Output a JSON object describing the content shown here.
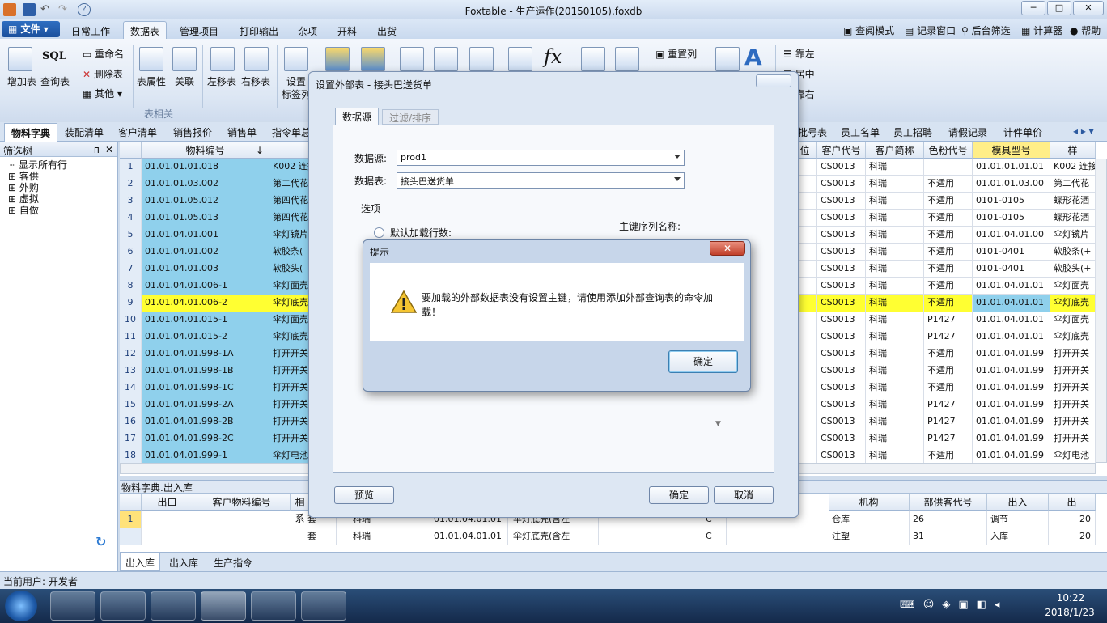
{
  "window": {
    "title": "Foxtable - 生产运作(20150105).foxdb",
    "min": "─",
    "max": "□",
    "close": "✕"
  },
  "menu": {
    "file": "文件",
    "items": [
      "日常工作",
      "数据表",
      "管理项目",
      "打印输出",
      "杂项",
      "开料",
      "出货"
    ],
    "active": 1,
    "right": [
      "查阅模式",
      "记录窗口",
      "后台筛选",
      "计算器",
      "帮助"
    ]
  },
  "ribbon": {
    "big": [
      {
        "label": "增加表"
      },
      {
        "label": "查询表"
      },
      {
        "label": "表属性"
      },
      {
        "label": "关联"
      },
      {
        "label": "左移表"
      },
      {
        "label": "右移表"
      },
      {
        "label": "设置"
      },
      {
        "label": "标签列"
      }
    ],
    "sql_text": "SQL",
    "small": [
      "重命名",
      "删除表",
      "其他"
    ],
    "group_label": "表相关",
    "right_small": [
      "重置列",
      "靠左",
      "居中",
      "靠右"
    ],
    "fx": "fx"
  },
  "tabs": [
    "物料字典",
    "装配清单",
    "客户清单",
    "销售报价",
    "销售单",
    "指令单总",
    "批号表",
    "员工名单",
    "员工招聘",
    "请假记录",
    "计件单价"
  ],
  "tree": {
    "title": "筛选树",
    "pin": "ᴨ",
    "close": "✕",
    "items": [
      "显示所有行",
      "客供",
      "外购",
      "虚拟",
      "自做"
    ]
  },
  "grid": {
    "left_headers": [
      "物料编号"
    ],
    "right_headers": [
      "位",
      "客户代号",
      "客户简称",
      "色粉代号",
      "模具型号",
      "样"
    ],
    "rows": [
      {
        "n": "1",
        "code": "01.01.01.01.018",
        "name": "K002 连接",
        "cust": "CS0013",
        "short": "科瑞",
        "color": "",
        "mold": "01.01.01.01.01",
        "spec": "K002 连接"
      },
      {
        "n": "2",
        "code": "01.01.01.03.002",
        "name": "第二代花",
        "cust": "CS0013",
        "short": "科瑞",
        "color": "不适用",
        "mold": "01.01.01.03.00",
        "spec": "第二代花"
      },
      {
        "n": "3",
        "code": "01.01.01.05.012",
        "name": "第四代花",
        "cust": "CS0013",
        "short": "科瑞",
        "color": "不适用",
        "mold": "0101-0105",
        "spec": "蝶形花洒"
      },
      {
        "n": "4",
        "code": "01.01.01.05.013",
        "name": "第四代花",
        "cust": "CS0013",
        "short": "科瑞",
        "color": "不适用",
        "mold": "0101-0105",
        "spec": "蝶形花洒"
      },
      {
        "n": "5",
        "code": "01.01.04.01.001",
        "name": "伞灯镜片",
        "cust": "CS0013",
        "short": "科瑞",
        "color": "不适用",
        "mold": "01.01.04.01.00",
        "spec": "伞灯镜片"
      },
      {
        "n": "6",
        "code": "01.01.04.01.002",
        "name": "软胶条(",
        "cust": "CS0013",
        "short": "科瑞",
        "color": "不适用",
        "mold": "0101-0401",
        "spec": "软胶条(+"
      },
      {
        "n": "7",
        "code": "01.01.04.01.003",
        "name": "软胶头(",
        "cust": "CS0013",
        "short": "科瑞",
        "color": "不适用",
        "mold": "0101-0401",
        "spec": "软胶头(+"
      },
      {
        "n": "8",
        "code": "01.01.04.01.006-1",
        "name": "伞灯面壳",
        "cust": "CS0013",
        "short": "科瑞",
        "color": "不适用",
        "mold": "01.01.04.01.01",
        "spec": "伞灯面壳"
      },
      {
        "n": "9",
        "code": "01.01.04.01.006-2",
        "name": "伞灯底壳",
        "cust": "CS0013",
        "short": "科瑞",
        "color": "不适用",
        "mold": "01.01.04.01.01",
        "spec": "伞灯底壳"
      },
      {
        "n": "10",
        "code": "01.01.04.01.015-1",
        "name": "伞灯面壳",
        "cust": "CS0013",
        "short": "科瑞",
        "color": "P1427",
        "mold": "01.01.04.01.01",
        "spec": "伞灯面壳"
      },
      {
        "n": "11",
        "code": "01.01.04.01.015-2",
        "name": "伞灯底壳",
        "cust": "CS0013",
        "short": "科瑞",
        "color": "P1427",
        "mold": "01.01.04.01.01",
        "spec": "伞灯底壳"
      },
      {
        "n": "12",
        "code": "01.01.04.01.998-1A",
        "name": "打开开关",
        "cust": "CS0013",
        "short": "科瑞",
        "color": "不适用",
        "mold": "01.01.04.01.99",
        "spec": "打开开关"
      },
      {
        "n": "13",
        "code": "01.01.04.01.998-1B",
        "name": "打开开关",
        "cust": "CS0013",
        "short": "科瑞",
        "color": "不适用",
        "mold": "01.01.04.01.99",
        "spec": "打开开关"
      },
      {
        "n": "14",
        "code": "01.01.04.01.998-1C",
        "name": "打开开关",
        "cust": "CS0013",
        "short": "科瑞",
        "color": "不适用",
        "mold": "01.01.04.01.99",
        "spec": "打开开关"
      },
      {
        "n": "15",
        "code": "01.01.04.01.998-2A",
        "name": "打开开关",
        "cust": "CS0013",
        "short": "科瑞",
        "color": "P1427",
        "mold": "01.01.04.01.99",
        "spec": "打开开关"
      },
      {
        "n": "16",
        "code": "01.01.04.01.998-2B",
        "name": "打开开关",
        "cust": "CS0013",
        "short": "科瑞",
        "color": "P1427",
        "mold": "01.01.04.01.99",
        "spec": "打开开关"
      },
      {
        "n": "17",
        "code": "01.01.04.01.998-2C",
        "name": "打开开关",
        "cust": "CS0013",
        "short": "科瑞",
        "color": "P1427",
        "mold": "01.01.04.01.99",
        "spec": "打开开关"
      },
      {
        "n": "18",
        "code": "01.01.04.01.999-1",
        "name": "伞灯电池",
        "cust": "CS0013",
        "short": "科瑞",
        "color": "不适用",
        "mold": "01.01.04.01.99",
        "spec": "伞灯电池"
      }
    ],
    "selected_row": 9
  },
  "bottom": {
    "title": "物料字典.出入库",
    "headers_left": [
      "出口",
      "客户物料编号",
      "相系"
    ],
    "headers_right": [
      "机构",
      "部供客代号",
      "出入",
      "出"
    ],
    "rows": [
      {
        "n": "1",
        "a": "套",
        "b": "科瑞",
        "c": "01.01.04.01.01",
        "d": "伞灯底壳(含左",
        "e": "C",
        "f": "仓库",
        "g": "26",
        "h": "调节",
        "i": "20"
      },
      {
        "n": "",
        "a": "套",
        "b": "科瑞",
        "c": "01.01.04.01.01",
        "d": "伞灯底壳(含左",
        "e": "C",
        "f": "注塑",
        "g": "31",
        "h": "入库",
        "i": "20"
      }
    ],
    "tabs": [
      "出入库",
      "出入库",
      "生产指令"
    ]
  },
  "status": {
    "user_label": "当前用户: 开发者"
  },
  "taskbar": {
    "time": "10:22",
    "date": "2018/1/23"
  },
  "dialog": {
    "title": "设置外部表 - 接头巴送货单",
    "tabs": [
      "数据源",
      "过滤/排序"
    ],
    "datasource_label": "数据源:",
    "datasource_value": "prod1",
    "datatable_label": "数据表:",
    "datatable_value": "接头巴送货单",
    "options_label": "选项",
    "default_rows_label": "默认加载行数:",
    "pk_label": "主键序列名称:",
    "preview": "预览",
    "ok": "确定",
    "cancel": "取消"
  },
  "msgbox": {
    "title": "提示",
    "text_line1": "要加载的外部数据表没有设置主键，请使用添加外部查询表的命令加",
    "text_line2": "载！",
    "ok": "确定",
    "close": "✕"
  },
  "colors": {
    "blue_cell": "#8fd0ec",
    "yellow_row": "#ffff32",
    "mold_header": "#ffee88"
  }
}
